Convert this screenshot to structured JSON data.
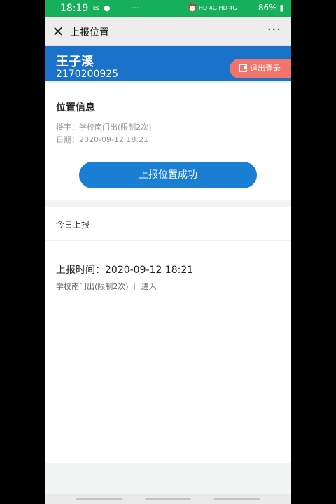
{
  "status_bar": {
    "time": "18:19",
    "icons_left": [
      "message-icon",
      "wechat-icon"
    ],
    "dots": "···",
    "indicators": "HD 4G HD 4G",
    "battery": "86%"
  },
  "nav": {
    "title": "上报位置",
    "close_symbol": "✕",
    "more_symbol": "···"
  },
  "user": {
    "name": "王子溪",
    "id": "2170200925",
    "logout_label": "退出登录"
  },
  "location_info": {
    "title": "位置信息",
    "building_line": "楼宇：学校南门出(限制2次)",
    "date_line": "日期：2020-09-12 18:21",
    "success_button": "上报位置成功"
  },
  "today": {
    "title": "今日上报",
    "records": [
      {
        "time_line": "上报时间：2020-09-12 18:21",
        "desc_line": "学校南门出(限制2次) ｜ 进入"
      }
    ]
  },
  "colors": {
    "status_bar": "#17b05a",
    "banner": "#1a72c9",
    "primary_button": "#1a7fd2",
    "logout_button": "#f0746a"
  }
}
